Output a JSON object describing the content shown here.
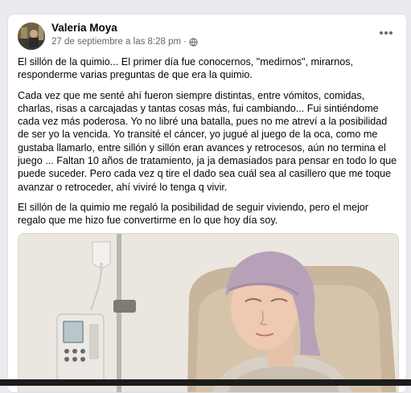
{
  "post": {
    "author": "Valeria Moya",
    "date": "27 de septiembre a las 8:28 pm",
    "separator": "·",
    "privacy_icon": "globe-icon",
    "more_icon": "more-options-icon",
    "paragraphs": [
      "El sillón de la quimio... El primer día fue conocernos, \"medirnos\", mirarnos, responderme varias preguntas de que era la quimio.",
      "Cada vez que me senté ahí fueron siempre distintas, entre vómitos, comidas, charlas, risas a carcajadas y tantas cosas más, fui cambiando... Fui sintiéndome cada vez más poderosa. Yo no libré una batalla, pues no me atreví a la posibilidad de ser yo la vencida. Yo transité el cáncer, yo jugué al juego de la oca, como me gustaba llamarlo, entre sillón y sillón eran avances y retrocesos, aún no termina el juego ... Faltan 10 años de tratamiento, ja ja demasiados para pensar en todo lo que puede suceder. Pero cada vez q tire el dado sea cuál sea al casillero que me toque avanzar o retroceder, ahí viviré lo tenga q vivir.",
      "El sillón de la quimio me regaló la posibilidad de seguir viviendo, pero el mejor regalo que me hizo fue convertirme en lo que hoy día soy."
    ]
  },
  "colors": {
    "background": "#e9ebee",
    "card": "#ffffff",
    "text": "#050505",
    "muted": "#65676b",
    "headscarf": "#b7a1b8"
  }
}
